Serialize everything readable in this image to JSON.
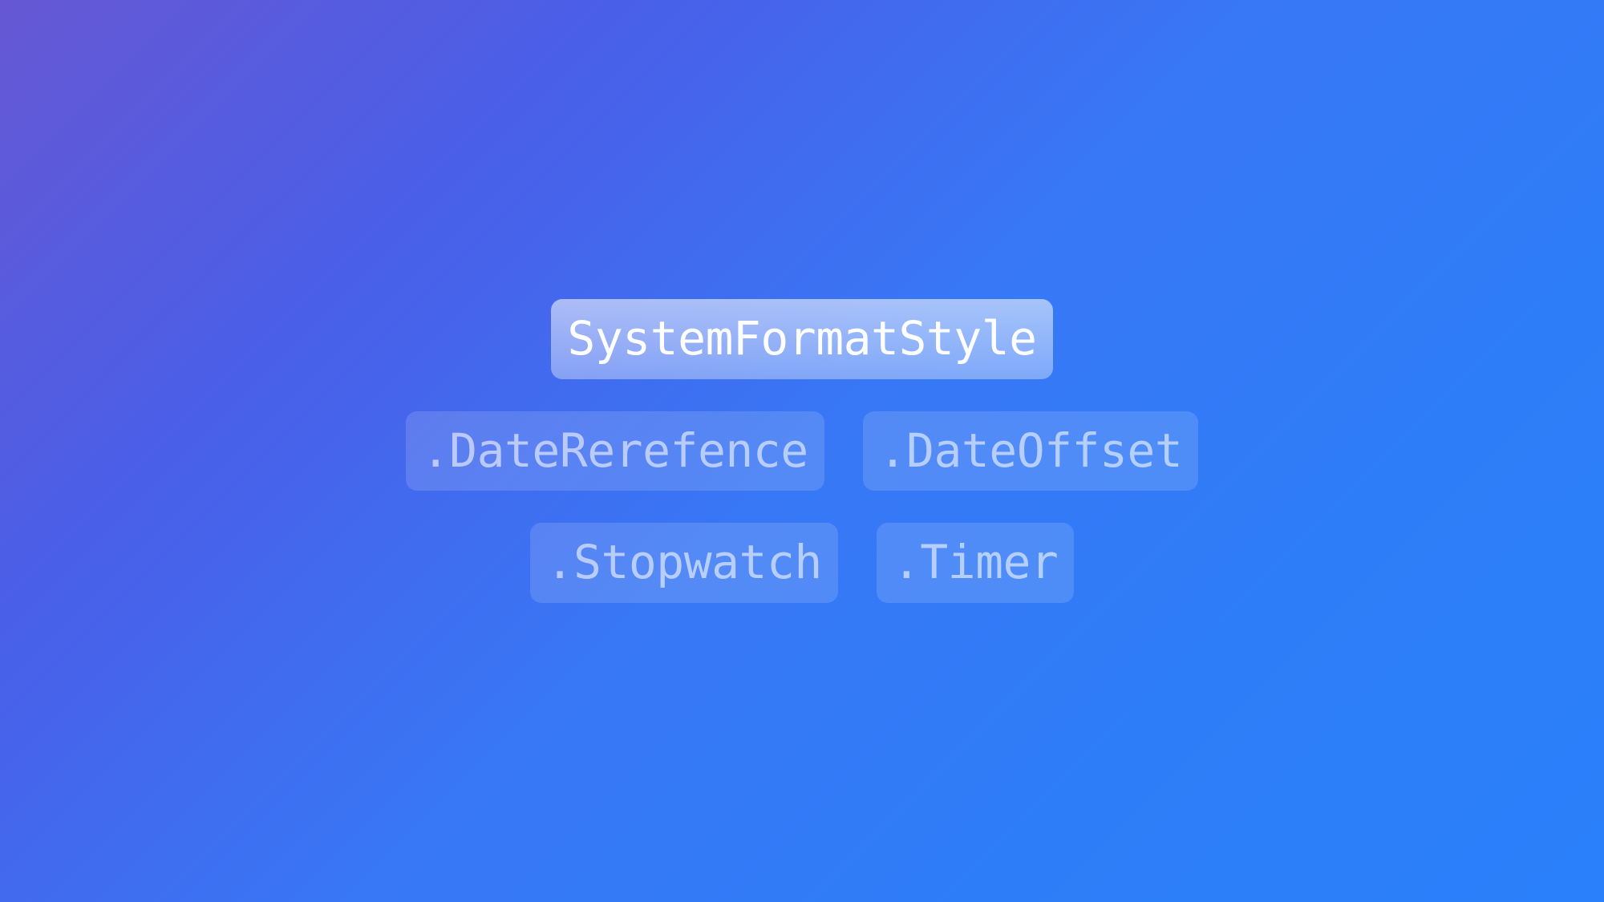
{
  "main": {
    "title": "SystemFormatStyle",
    "subtypes": {
      "row1": [
        ".DateRerefence",
        ".DateOffset"
      ],
      "row2": [
        ".Stopwatch",
        ".Timer"
      ]
    }
  }
}
